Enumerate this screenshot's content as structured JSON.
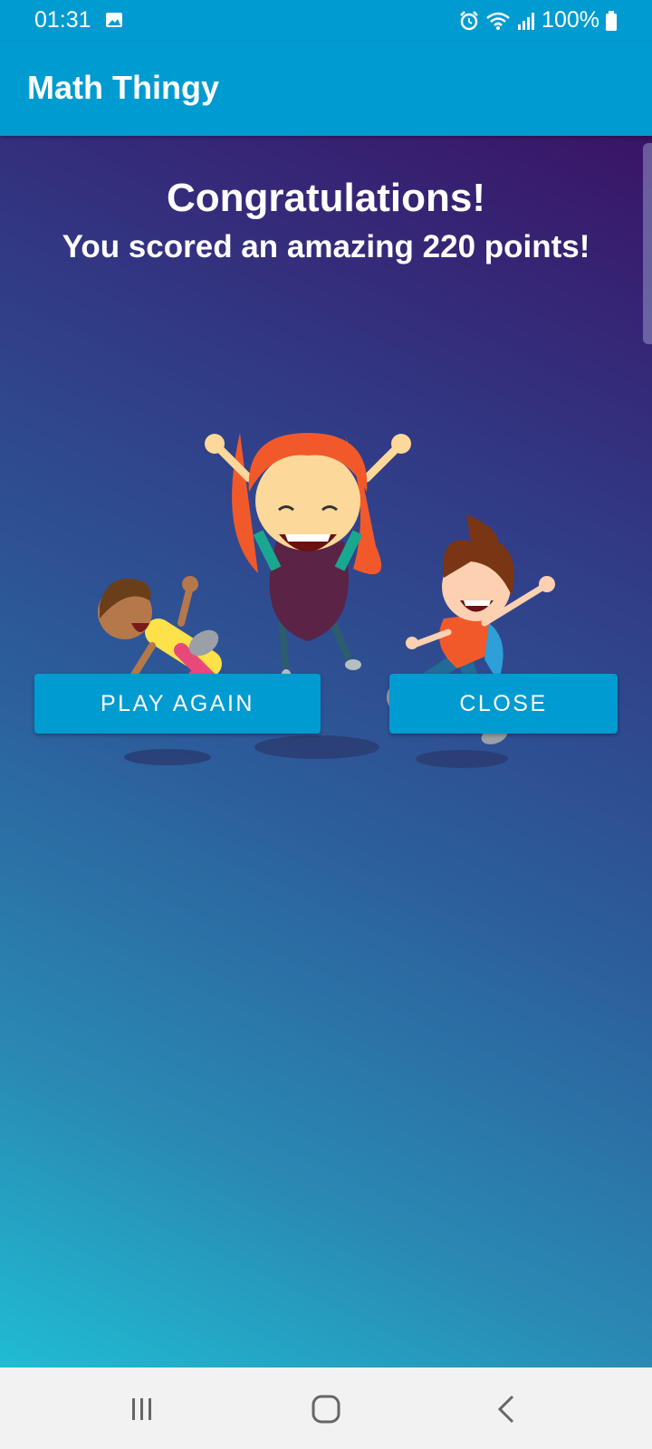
{
  "status_bar": {
    "time": "01:31",
    "battery": "100%",
    "icons": [
      "image-icon",
      "alarm-icon",
      "wifi-icon",
      "signal-icon",
      "battery-icon"
    ]
  },
  "app_bar": {
    "title": "Math Thingy"
  },
  "result": {
    "title": "Congratulations!",
    "score_message": "You scored an amazing 220 points!"
  },
  "illustration": {
    "subject": "three cheering jumping kids"
  },
  "buttons": {
    "play_again": "PLAY AGAIN",
    "close": "CLOSE"
  },
  "navigation": {
    "icons": [
      "recent-apps-icon",
      "home-icon",
      "back-icon"
    ]
  },
  "colors": {
    "app_bar": "#009bd1",
    "button": "#009bd1",
    "gradient_top": "#3a1466",
    "gradient_bottom": "#20bcd3",
    "nav_bar": "#f2f2f2"
  }
}
